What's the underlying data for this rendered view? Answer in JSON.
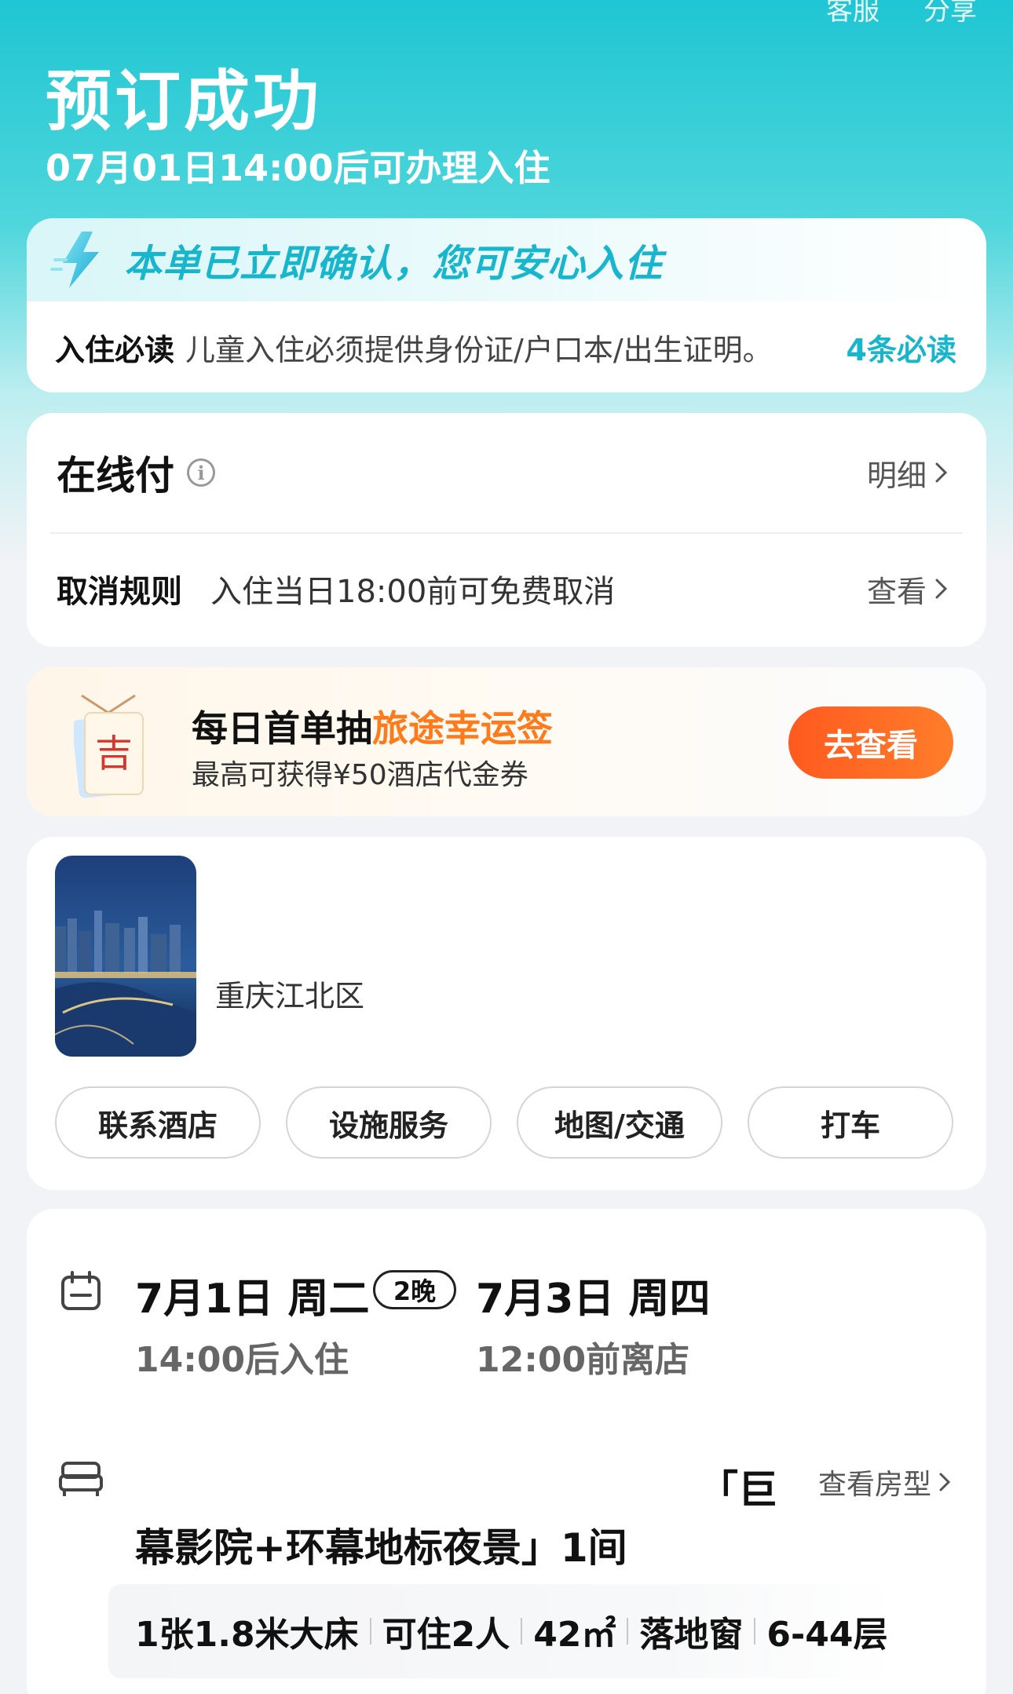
{
  "header": {
    "actions": [
      "客服",
      "分享"
    ],
    "title": "预订成功",
    "subtitle": "07月01日14:00后可办理入住"
  },
  "confirm": {
    "banner_text": "本单已立即确认，您可安心入住",
    "notice_label": "入住必读",
    "notice_text": "儿童入住必须提供身份证/户口本/出生证明。",
    "notice_link": "4条必读"
  },
  "payment": {
    "title": "在线付",
    "info_glyph": "i",
    "detail_link": "明细",
    "cancel_label": "取消规则",
    "cancel_text": "入住当日18:00前可免费取消",
    "cancel_link": "查看"
  },
  "promo": {
    "charm_char": "吉",
    "title_prefix": "每日首单抽",
    "title_highlight": "旅途幸运签",
    "subtitle": "最高可获得¥50酒店代金券",
    "button": "去查看"
  },
  "hotel": {
    "address": "重庆江北区",
    "buttons": [
      "联系酒店",
      "设施服务",
      "地图/交通",
      "打车"
    ]
  },
  "stay": {
    "checkin_date": "7月1日 周二",
    "nights": "2晚",
    "checkout_date": "7月3日 周四",
    "checkin_time": "14:00后入住",
    "checkout_time": "12:00前离店",
    "room_name_line1": "「巨",
    "room_name_line2": "幕影院+环幕地标夜景」1间",
    "room_link": "查看房型",
    "room_tags": [
      "1张1.8米大床",
      "可住2人",
      "42㎡",
      "落地窗",
      "6-44层"
    ]
  },
  "colors": {
    "accent": "#17b6cc",
    "promo_orange": "#ff7a1a",
    "button_orange": "#ff5a1f"
  }
}
